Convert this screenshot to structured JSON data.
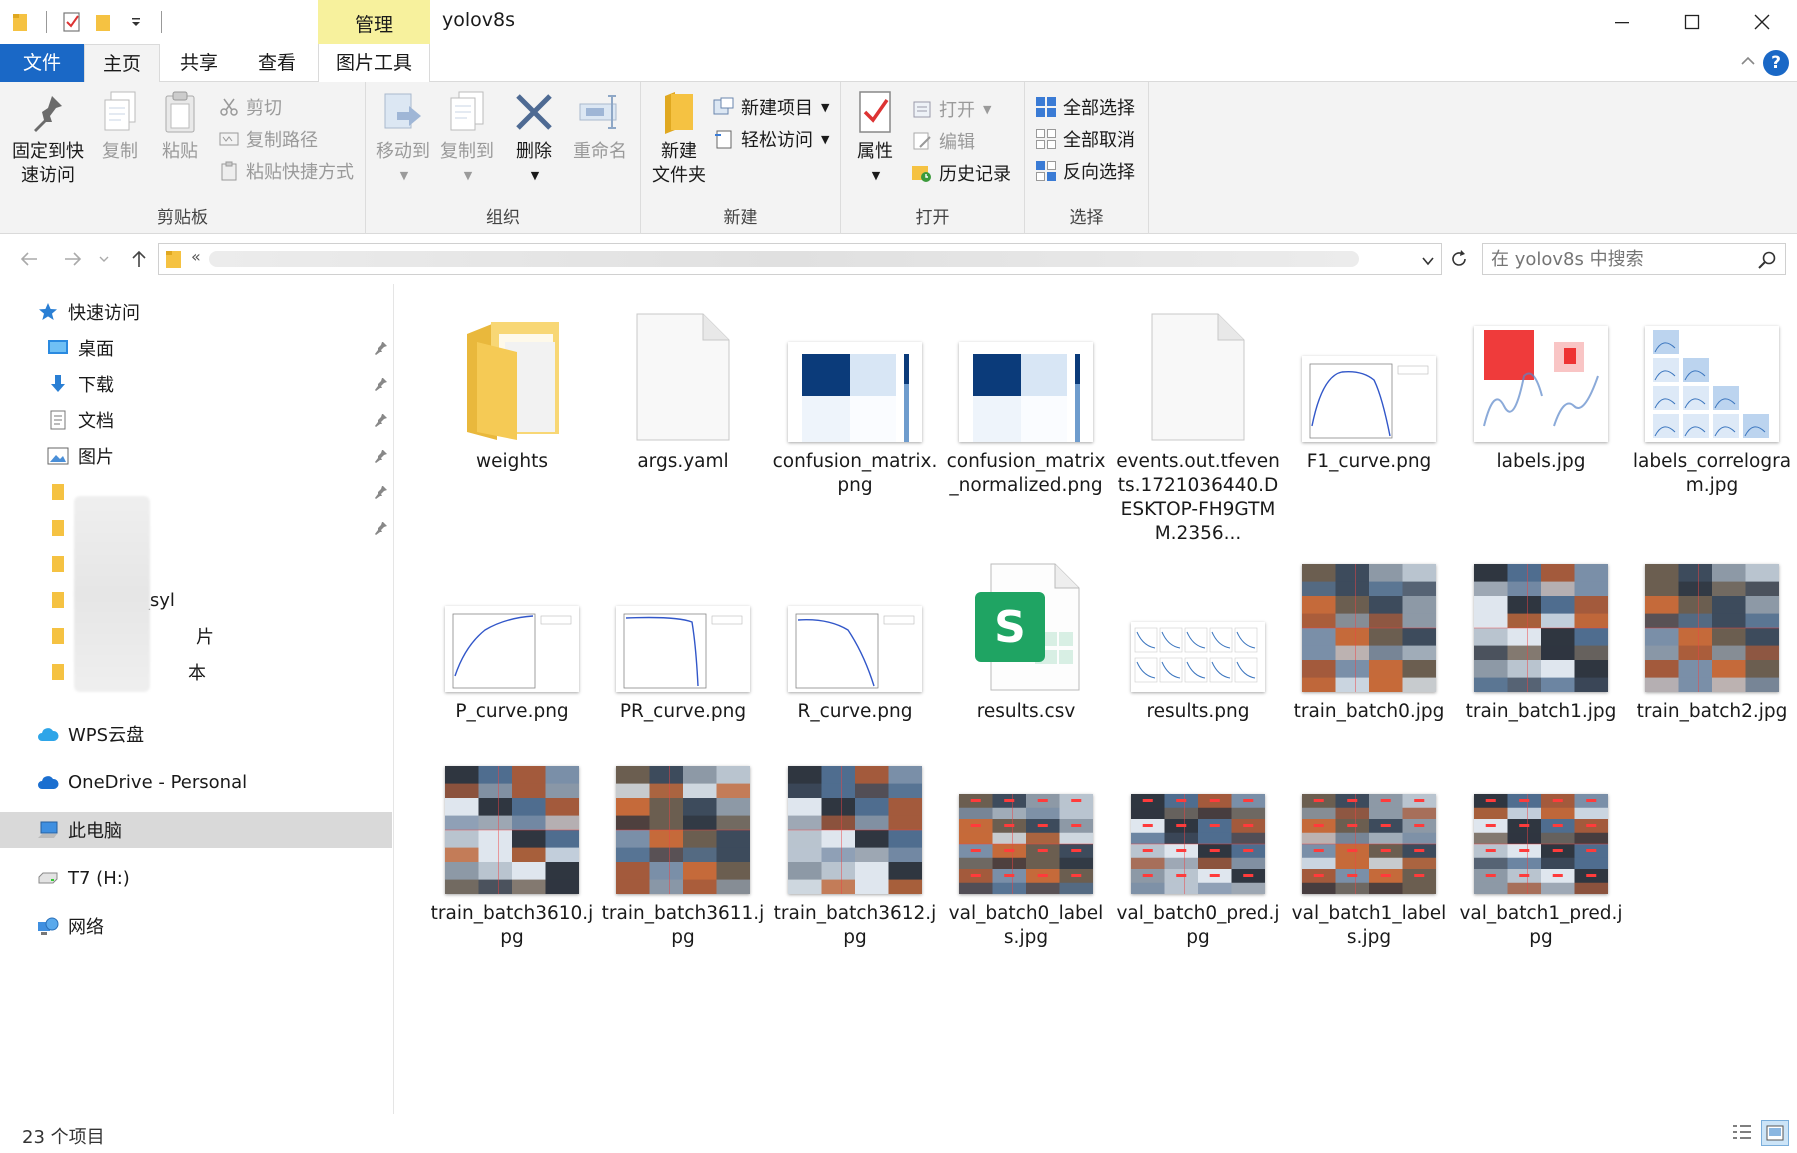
{
  "window": {
    "title": "yolov8s",
    "context_tab": "管理"
  },
  "tabs": {
    "file": "文件",
    "home": "主页",
    "share": "共享",
    "view": "查看",
    "picture_tools": "图片工具"
  },
  "ribbon": {
    "clipboard": {
      "label": "剪贴板",
      "pin": "固定到快速访问",
      "pin_line1": "固定到快",
      "pin_line2": "速访问",
      "copy": "复制",
      "paste": "粘贴",
      "cut": "剪切",
      "copy_path": "复制路径",
      "paste_shortcut": "粘贴快捷方式"
    },
    "organize": {
      "label": "组织",
      "move_to": "移动到",
      "copy_to": "复制到",
      "delete": "删除",
      "rename": "重命名"
    },
    "new": {
      "label": "新建",
      "new_folder_line1": "新建",
      "new_folder_line2": "文件夹",
      "new_item": "新建项目",
      "easy_access": "轻松访问"
    },
    "open": {
      "label": "打开",
      "properties": "属性",
      "open": "打开",
      "edit": "编辑",
      "history": "历史记录"
    },
    "select": {
      "label": "选择",
      "select_all": "全部选择",
      "select_none": "全部取消",
      "invert": "反向选择"
    }
  },
  "address": {
    "crumb_prefix": "«",
    "search_placeholder": "在 yolov8s 中搜索"
  },
  "nav": {
    "quick_access": "快速访问",
    "desktop": "桌面",
    "downloads": "下载",
    "documents": "文档",
    "pictures": "图片",
    "partial1": "08_syl",
    "partial2": "片",
    "partial3": "本",
    "wps": "WPS云盘",
    "onedrive": "OneDrive - Personal",
    "thispc": "此电脑",
    "t7": "T7 (H:)",
    "network": "网络"
  },
  "files": [
    {
      "name": "weights",
      "kind": "folder"
    },
    {
      "name": "args.yaml",
      "kind": "blank"
    },
    {
      "name": "confusion_matrix.png",
      "kind": "confusion"
    },
    {
      "name": "confusion_matrix_normalized.png",
      "kind": "confusion2"
    },
    {
      "name": "events.out.tfevents.1721036440.DESKTOP-FH9GTMM.2356...",
      "kind": "blank"
    },
    {
      "name": "F1_curve.png",
      "kind": "f1"
    },
    {
      "name": "labels.jpg",
      "kind": "labels"
    },
    {
      "name": "labels_correlogram.jpg",
      "kind": "correlogram"
    },
    {
      "name": "P_curve.png",
      "kind": "pcurve"
    },
    {
      "name": "PR_curve.png",
      "kind": "prcurve"
    },
    {
      "name": "R_curve.png",
      "kind": "rcurve"
    },
    {
      "name": "results.csv",
      "kind": "csv"
    },
    {
      "name": "results.png",
      "kind": "results"
    },
    {
      "name": "train_batch0.jpg",
      "kind": "mosaic"
    },
    {
      "name": "train_batch1.jpg",
      "kind": "mosaic"
    },
    {
      "name": "train_batch2.jpg",
      "kind": "mosaic"
    },
    {
      "name": "train_batch3610.jpg",
      "kind": "mosaic"
    },
    {
      "name": "train_batch3611.jpg",
      "kind": "mosaic"
    },
    {
      "name": "train_batch3612.jpg",
      "kind": "mosaic"
    },
    {
      "name": "val_batch0_labels.jpg",
      "kind": "valmosaic"
    },
    {
      "name": "val_batch0_pred.jpg",
      "kind": "valmosaic"
    },
    {
      "name": "val_batch1_labels.jpg",
      "kind": "valmosaic"
    },
    {
      "name": "val_batch1_pred.jpg",
      "kind": "valmosaic"
    }
  ],
  "status": {
    "count": "23 个项目"
  },
  "colors": {
    "accent": "#1a68c6",
    "manage_tab": "#f7f19d",
    "folder": "#f8d775",
    "selected_nav": "#d9d9d9"
  }
}
